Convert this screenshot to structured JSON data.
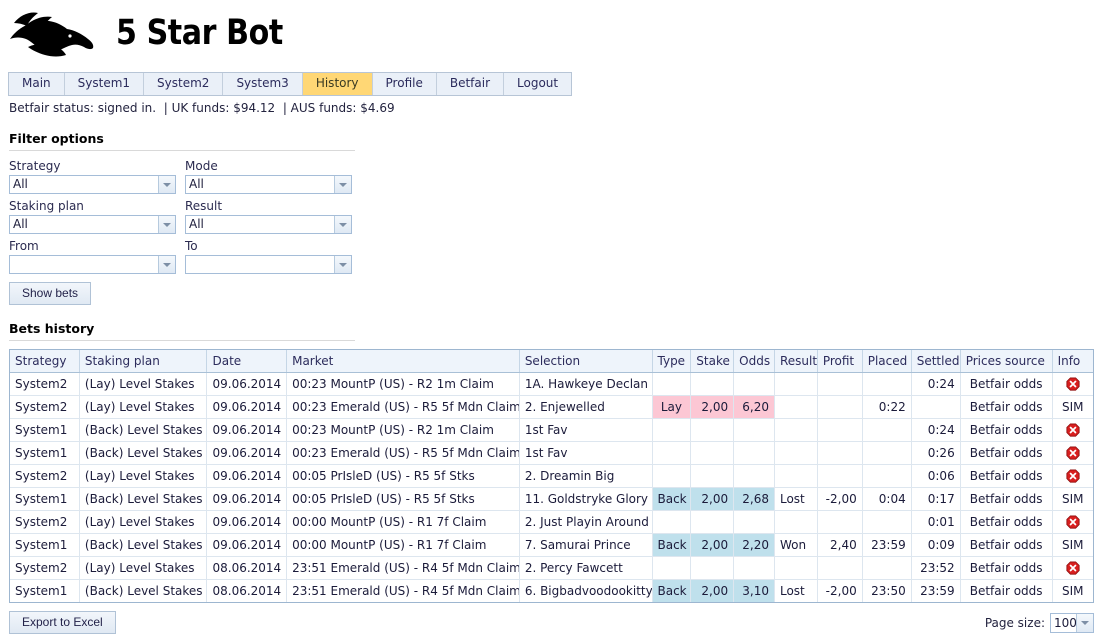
{
  "app": {
    "title": "5 Star Bot",
    "logo_icon": "bronco-horse-head-logo"
  },
  "nav": {
    "tabs": [
      {
        "label": "Main",
        "active": false
      },
      {
        "label": "System1",
        "active": false
      },
      {
        "label": "System2",
        "active": false
      },
      {
        "label": "System3",
        "active": false
      },
      {
        "label": "History",
        "active": true
      },
      {
        "label": "Profile",
        "active": false
      },
      {
        "label": "Betfair",
        "active": false
      },
      {
        "label": "Logout",
        "active": false
      }
    ],
    "active_tab_color": "#ffd775"
  },
  "status": {
    "text": "Betfair status: signed in.  | UK funds: $94.12  | AUS funds: $4.69",
    "betfair_status": "signed in.",
    "uk_funds": "$94.12",
    "aus_funds": "$4.69"
  },
  "filters": {
    "title": "Filter options",
    "fields": [
      {
        "label": "Strategy",
        "value": "All",
        "placeholder": ""
      },
      {
        "label": "Mode",
        "value": "All",
        "placeholder": ""
      },
      {
        "label": "Staking plan",
        "value": "All",
        "placeholder": ""
      },
      {
        "label": "Result",
        "value": "All",
        "placeholder": ""
      },
      {
        "label": "From",
        "value": "",
        "placeholder": ""
      },
      {
        "label": "To",
        "value": "",
        "placeholder": ""
      }
    ],
    "show_bets_label": "Show bets"
  },
  "bets_history": {
    "title": "Bets history",
    "columns": [
      "Strategy",
      "Staking plan",
      "Date",
      "Market",
      "Selection",
      "Type",
      "Stake",
      "Odds",
      "Result",
      "Profit",
      "Placed",
      "Settled",
      "Prices source",
      "Info"
    ],
    "rows": [
      {
        "strategy": "System2",
        "staking_plan": "(Lay) Level Stakes",
        "date": "09.06.2014",
        "market": "00:23 MountP (US) - R2 1m Claim",
        "selection": "1A. Hawkeye Declan",
        "type": "",
        "stake": "",
        "odds": "",
        "result": "",
        "profit": "",
        "placed": "",
        "settled": "0:24",
        "prices_source": "Betfair odds",
        "info": "error",
        "bet_side": ""
      },
      {
        "strategy": "System2",
        "staking_plan": "(Lay) Level Stakes",
        "date": "09.06.2014",
        "market": "00:23 Emerald (US) - R5 5f Mdn Claim",
        "selection": "2. Enjewelled",
        "type": "Lay",
        "stake": "2,00",
        "odds": "6,20",
        "result": "",
        "profit": "",
        "placed": "0:22",
        "settled": "",
        "prices_source": "Betfair odds",
        "info": "SIM",
        "bet_side": "lay"
      },
      {
        "strategy": "System1",
        "staking_plan": "(Back) Level Stakes",
        "date": "09.06.2014",
        "market": "00:23 MountP (US) - R2 1m Claim",
        "selection": "1st Fav",
        "type": "",
        "stake": "",
        "odds": "",
        "result": "",
        "profit": "",
        "placed": "",
        "settled": "0:24",
        "prices_source": "Betfair odds",
        "info": "error",
        "bet_side": ""
      },
      {
        "strategy": "System1",
        "staking_plan": "(Back) Level Stakes",
        "date": "09.06.2014",
        "market": "00:23 Emerald (US) - R5 5f Mdn Claim",
        "selection": "1st Fav",
        "type": "",
        "stake": "",
        "odds": "",
        "result": "",
        "profit": "",
        "placed": "",
        "settled": "0:26",
        "prices_source": "Betfair odds",
        "info": "error",
        "bet_side": ""
      },
      {
        "strategy": "System2",
        "staking_plan": "(Lay) Level Stakes",
        "date": "09.06.2014",
        "market": "00:05 PrIsleD (US) - R5 5f Stks",
        "selection": "2. Dreamin Big",
        "type": "",
        "stake": "",
        "odds": "",
        "result": "",
        "profit": "",
        "placed": "",
        "settled": "0:06",
        "prices_source": "Betfair odds",
        "info": "error",
        "bet_side": ""
      },
      {
        "strategy": "System1",
        "staking_plan": "(Back) Level Stakes",
        "date": "09.06.2014",
        "market": "00:05 PrIsleD (US) - R5 5f Stks",
        "selection": "11. Goldstryke Glory",
        "type": "Back",
        "stake": "2,00",
        "odds": "2,68",
        "result": "Lost",
        "profit": "-2,00",
        "placed": "0:04",
        "settled": "0:17",
        "prices_source": "Betfair odds",
        "info": "SIM",
        "bet_side": "back"
      },
      {
        "strategy": "System2",
        "staking_plan": "(Lay) Level Stakes",
        "date": "09.06.2014",
        "market": "00:00 MountP (US) - R1 7f Claim",
        "selection": "2. Just Playin Around",
        "type": "",
        "stake": "",
        "odds": "",
        "result": "",
        "profit": "",
        "placed": "",
        "settled": "0:01",
        "prices_source": "Betfair odds",
        "info": "error",
        "bet_side": ""
      },
      {
        "strategy": "System1",
        "staking_plan": "(Back) Level Stakes",
        "date": "09.06.2014",
        "market": "00:00 MountP (US) - R1 7f Claim",
        "selection": "7. Samurai Prince",
        "type": "Back",
        "stake": "2,00",
        "odds": "2,20",
        "result": "Won",
        "profit": "2,40",
        "placed": "23:59",
        "settled": "0:09",
        "prices_source": "Betfair odds",
        "info": "SIM",
        "bet_side": "back"
      },
      {
        "strategy": "System2",
        "staking_plan": "(Lay) Level Stakes",
        "date": "08.06.2014",
        "market": "23:51 Emerald (US) - R4 5f Mdn Claim",
        "selection": "2. Percy Fawcett",
        "type": "",
        "stake": "",
        "odds": "",
        "result": "",
        "profit": "",
        "placed": "",
        "settled": "23:52",
        "prices_source": "Betfair odds",
        "info": "error",
        "bet_side": ""
      },
      {
        "strategy": "System1",
        "staking_plan": "(Back) Level Stakes",
        "date": "08.06.2014",
        "market": "23:51 Emerald (US) - R4 5f Mdn Claim",
        "selection": "6. Bigbadvoodookitty",
        "type": "Back",
        "stake": "2,00",
        "odds": "3,10",
        "result": "Lost",
        "profit": "-2,00",
        "placed": "23:50",
        "settled": "23:59",
        "prices_source": "Betfair odds",
        "info": "SIM",
        "bet_side": "back"
      }
    ]
  },
  "footer": {
    "export_label": "Export to Excel",
    "page_size_label": "Page size:",
    "page_size_value": "100"
  },
  "colors": {
    "lay_highlight": "#fcc7d4",
    "back_highlight": "#bfe0ec",
    "profit_negative": "#e01b1b",
    "profit_positive": "#2f8f2f",
    "header_bg": "#eef4fb",
    "active_tab": "#ffd775"
  }
}
